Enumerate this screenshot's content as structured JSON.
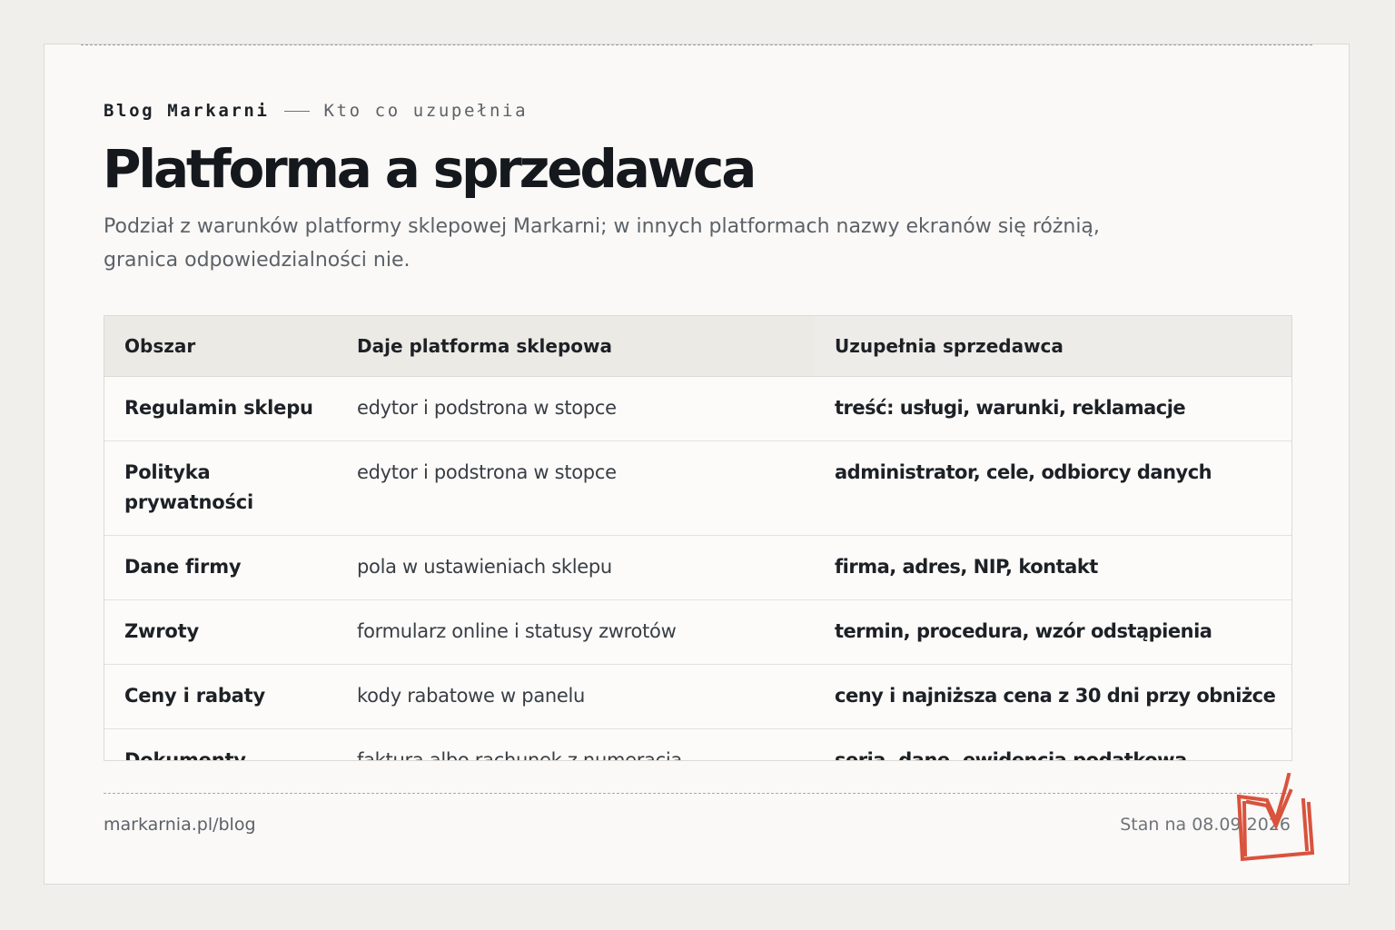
{
  "header": {
    "brand": "Blog Markarni",
    "section": "Kto co uzupełnia",
    "title": "Platforma a sprzedawca",
    "subtitle": "Podział z warunków platformy sklepowej Markarni; w innych platformach nazwy ekranów się różnią, granica odpowiedzialności nie."
  },
  "table": {
    "columns": [
      "Obszar",
      "Daje platforma sklepowa",
      "Uzupełnia sprzedawca"
    ],
    "rows": [
      {
        "area": "Regulamin sklepu",
        "platform": "edytor i podstrona w stopce",
        "seller": "treść: usługi, warunki, reklamacje"
      },
      {
        "area": "Polityka prywatności",
        "platform": "edytor i podstrona w stopce",
        "seller": "administrator, cele, odbiorcy danych"
      },
      {
        "area": "Dane firmy",
        "platform": "pola w ustawieniach sklepu",
        "seller": "firma, adres, NIP, kontakt"
      },
      {
        "area": "Zwroty",
        "platform": "formularz online i statusy zwrotów",
        "seller": "termin, procedura, wzór odstąpienia"
      },
      {
        "area": "Ceny i rabaty",
        "platform": "kody rabatowe w panelu",
        "seller": "ceny i najniższa cena z 30 dni przy obniżce"
      },
      {
        "area": "Dokumenty",
        "platform": "faktura albo rachunek z numeracją",
        "seller": "seria, dane, ewidencja podatkowa"
      }
    ]
  },
  "footer": {
    "url": "markarnia.pl/blog",
    "date": "Stan na 08.09.2026"
  },
  "logo": {
    "icon": "markarnia-m-logo-icon",
    "color": "#d9533d"
  }
}
